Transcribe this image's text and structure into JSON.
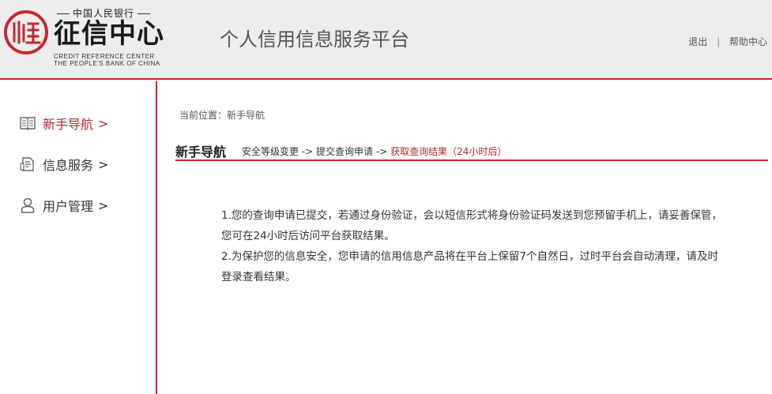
{
  "header": {
    "logo": {
      "top_text": "中国人民银行",
      "main_text": "征信中心",
      "en_line1": "CREDIT REFERENCE CENTER",
      "en_line2": "THE PEOPLE'S BANK OF CHINA"
    },
    "platform_title": "个人信用信息服务平台",
    "links": {
      "logout": "退出",
      "separator": "|",
      "help": "帮助中心"
    }
  },
  "sidebar": {
    "items": [
      {
        "label": "新手导航",
        "arrow": ">",
        "icon": "book-icon",
        "active": true
      },
      {
        "label": "信息服务",
        "arrow": ">",
        "icon": "document-icon",
        "active": false
      },
      {
        "label": "用户管理",
        "arrow": ">",
        "icon": "user-icon",
        "active": false
      }
    ]
  },
  "main": {
    "breadcrumb": "当前位置：新手导航",
    "section_title": "新手导航",
    "steps": {
      "step1": "安全等级变更",
      "arrow": " -> ",
      "step2": "提交查询申请",
      "step3": "获取查询结果（24小时后）"
    },
    "paragraphs": [
      "1.您的查询申请已提交，若通过身份验证，会以短信形式将身份验证码发送到您预留手机上，请妥善保管，您可在24小时后访问平台获取结果。",
      "2.为保护您的信息安全，您申请的信用信息产品将在平台上保留7个自然日，过时平台会自动清理，请及时登录查看结果。"
    ]
  },
  "colors": {
    "accent": "#c5282e",
    "active_text": "#b3282d",
    "header_bg": "#ededed"
  }
}
